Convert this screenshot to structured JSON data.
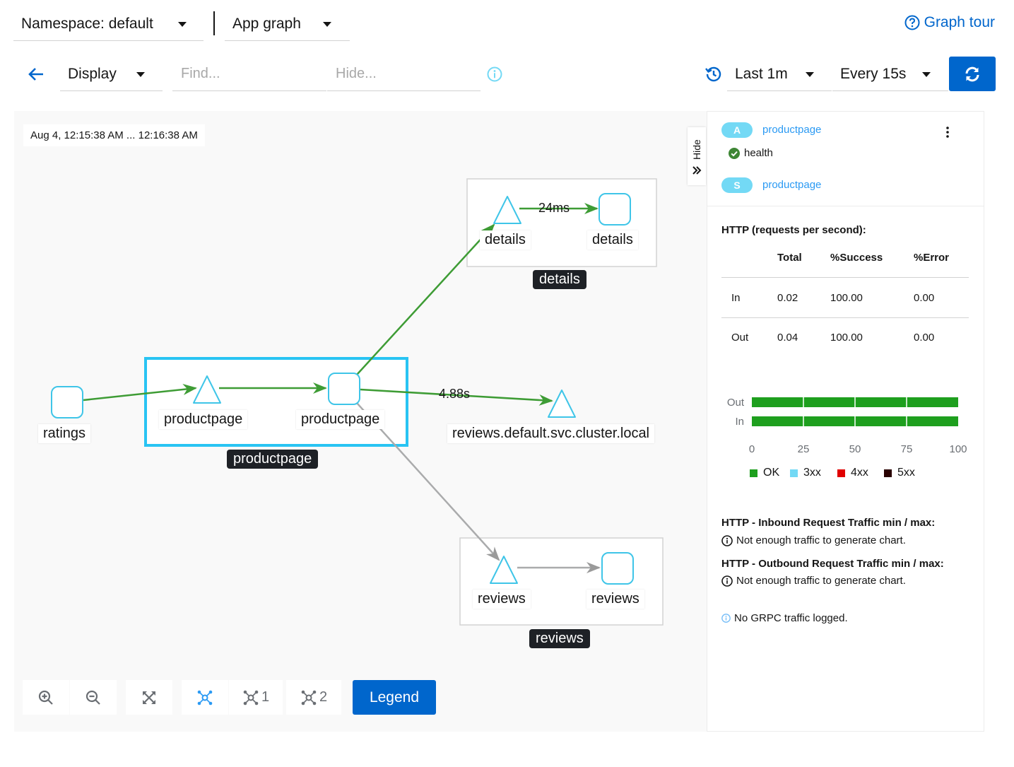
{
  "header": {
    "namespace_label": "Namespace: default",
    "graph_type_label": "App graph",
    "graph_tour_label": "Graph tour"
  },
  "toolbar": {
    "display_label": "Display",
    "find_placeholder": "Find...",
    "hide_placeholder": "Hide...",
    "duration_label": "Last 1m",
    "refresh_interval_label": "Every 15s"
  },
  "graph": {
    "timestamp": "Aug 4, 12:15:38 AM ... 12:16:38 AM",
    "nodes": {
      "ratings": "ratings",
      "productpage_app": "productpage",
      "productpage_workload": "productpage",
      "details_app": "details",
      "details_workload": "details",
      "reviews_service": "reviews.default.svc.cluster.local",
      "reviews_app": "reviews",
      "reviews_workload": "reviews"
    },
    "groups": {
      "productpage": "productpage",
      "details": "details",
      "reviews": "reviews"
    },
    "edges": {
      "details_latency": "24ms",
      "reviews_latency": "4.88s"
    },
    "colors": {
      "healthy_edge": "#3e9c35",
      "idle_edge": "#aaabac",
      "node_border": "#3fc5e8",
      "selected_box": "#29c4f3"
    }
  },
  "controls": {
    "hide_label": "Hide",
    "layout1_label": "1",
    "layout2_label": "2",
    "legend_label": "Legend"
  },
  "panel": {
    "app_badge": "A",
    "app_name": "productpage",
    "health_label": "health",
    "service_badge": "S",
    "service_name": "productpage",
    "http_title": "HTTP (requests per second):",
    "table": {
      "headers": [
        "Total",
        "%Success",
        "%Error"
      ],
      "rows": [
        {
          "label": "In",
          "total": "0.02",
          "success": "100.00",
          "error": "0.00"
        },
        {
          "label": "Out",
          "total": "0.04",
          "success": "100.00",
          "error": "0.00"
        }
      ]
    },
    "inbound_title": "HTTP - Inbound Request Traffic min / max:",
    "inbound_note": "Not enough traffic to generate chart.",
    "outbound_title": "HTTP - Outbound Request Traffic min / max:",
    "outbound_note": "Not enough traffic to generate chart.",
    "grpc_note": "No GRPC traffic logged."
  },
  "chart_data": {
    "type": "bar",
    "orientation": "horizontal",
    "categories": [
      "Out",
      "In"
    ],
    "series": [
      {
        "name": "OK",
        "values": [
          100,
          100
        ],
        "color": "#1e9f1e"
      },
      {
        "name": "3xx",
        "values": [
          0,
          0
        ],
        "color": "#73d9f5"
      },
      {
        "name": "4xx",
        "values": [
          0,
          0
        ],
        "color": "#e00000"
      },
      {
        "name": "5xx",
        "values": [
          0,
          0
        ],
        "color": "#290000"
      }
    ],
    "xticks": [
      "0",
      "25",
      "50",
      "75",
      "100"
    ],
    "xlim": [
      0,
      100
    ],
    "stacked": true,
    "grid": true,
    "legend": "bottom"
  }
}
